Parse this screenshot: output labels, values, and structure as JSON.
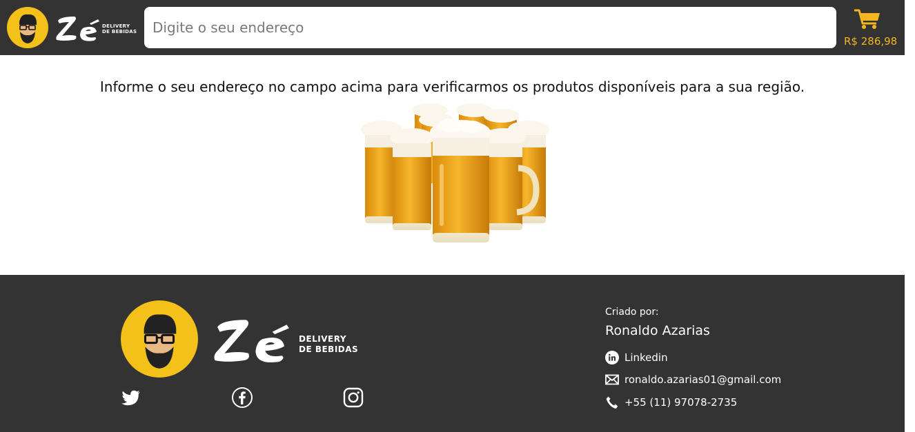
{
  "header": {
    "brand_tagline_line1": "DELIVERY",
    "brand_tagline_line2": "DE BEBIDAS",
    "search_placeholder": "Digite o seu endereço",
    "cart_total": "R$ 286,98"
  },
  "main": {
    "info_text": "Informe o seu endereço no campo acima para verificarmos os produtos disponíveis para a sua região."
  },
  "footer": {
    "brand_tagline_line1": "DELIVERY",
    "brand_tagline_line2": "DE BEBIDAS",
    "social_icons": [
      "twitter-icon",
      "facebook-icon",
      "instagram-icon"
    ],
    "created_by_label": "Criado por:",
    "author_name": "Ronaldo Azarias",
    "linkedin_label": "Linkedin",
    "email": "ronaldo.azarias01@gmail.com",
    "phone": "+55 (11) 97078-2735"
  },
  "colors": {
    "bar_background": "#333333",
    "accent_yellow": "#f3b61f",
    "text_white": "#ffffff"
  }
}
